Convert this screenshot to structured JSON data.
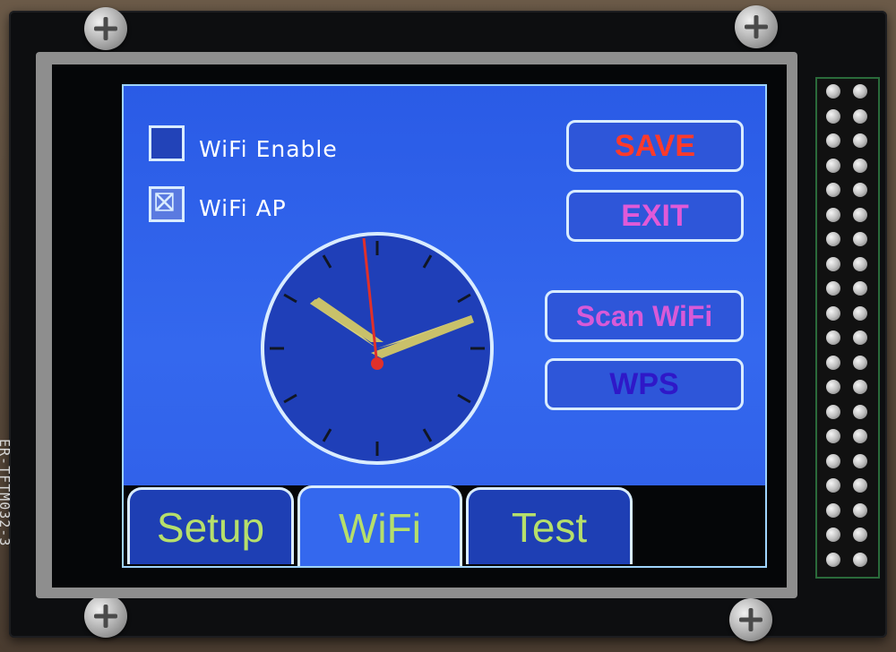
{
  "pcb": {
    "label": "ER-TFTM032-3"
  },
  "checkboxes": [
    {
      "label": "WiFi Enable",
      "checked": false
    },
    {
      "label": "WiFi AP",
      "checked": true
    }
  ],
  "buttons": {
    "save": {
      "label": "SAVE",
      "color": "#ff3a2a"
    },
    "exit": {
      "label": "EXIT",
      "color": "#e05ad8"
    },
    "scan": {
      "label": "Scan WiFi",
      "color": "#d85ad8"
    },
    "wps": {
      "label": "WPS",
      "color": "#2f18c8"
    }
  },
  "tabs": [
    {
      "label": "Setup",
      "active": false
    },
    {
      "label": "WiFi",
      "active": true
    },
    {
      "label": "Test",
      "active": false
    }
  ],
  "clock": {
    "hour_hand_color": "#d8d17a",
    "second_hand_color": "#e0302a",
    "face_color": "#1f3fb8",
    "rim_color": "#d9ecff"
  }
}
